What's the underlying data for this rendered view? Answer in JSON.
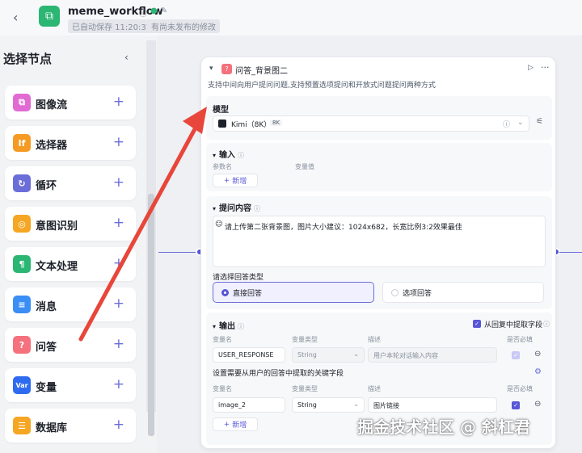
{
  "header": {
    "title": "meme_workflow",
    "saved_status": "已自动保存 11:20:37",
    "publish_status": "有尚未发布的修改"
  },
  "sidebar": {
    "title": "选择节点",
    "items": [
      {
        "label": "图像流",
        "icon": "image-flow-icon",
        "color": "#e16bd3",
        "glyph": "⧉"
      },
      {
        "label": "选择器",
        "icon": "selector-icon",
        "color": "#f59a23",
        "glyph": "If"
      },
      {
        "label": "循环",
        "icon": "loop-icon",
        "color": "#6b6ed8",
        "glyph": "↻"
      },
      {
        "label": "意图识别",
        "icon": "intent-icon",
        "color": "#f5a623",
        "glyph": "◎"
      },
      {
        "label": "文本处理",
        "icon": "text-process-icon",
        "color": "#2bb673",
        "glyph": "¶"
      },
      {
        "label": "消息",
        "icon": "message-icon",
        "color": "#3a8ef6",
        "glyph": "≡"
      },
      {
        "label": "问答",
        "icon": "qa-icon",
        "color": "#f4717d",
        "glyph": "?"
      },
      {
        "label": "变量",
        "icon": "variable-icon",
        "color": "#2f6bf0",
        "glyph": "Var"
      },
      {
        "label": "数据库",
        "icon": "database-icon",
        "color": "#f5a623",
        "glyph": "☰"
      }
    ]
  },
  "node": {
    "title": "问答_背景图二",
    "description": "支持中间向用户提问问题,支持预置选项提问和开放式问题提问两种方式",
    "model": {
      "section_label": "模型",
      "name": "Kimi（8K）",
      "tag": "8K"
    },
    "input": {
      "section_label": "输入",
      "col_param": "参数名",
      "col_value": "变量值",
      "add_label": "新增"
    },
    "prompt": {
      "section_label": "提问内容",
      "text": "请上传第二张背景图，图片大小建议：1024x682，长宽比例3:2效果最佳"
    },
    "reply_type": {
      "label": "请选择回答类型",
      "options": [
        "直接回答",
        "选项回答"
      ],
      "selected": "直接回答"
    },
    "output": {
      "section_label": "输出",
      "extract_label": "从回复中提取字段",
      "extract_checked": true,
      "col_name": "变量名",
      "col_type": "变量类型",
      "col_desc": "描述",
      "col_required": "是否必填",
      "row1": {
        "name": "USER_RESPONSE",
        "type": "String",
        "desc": "用户本轮对话输入内容"
      },
      "key_fields_label": "设置需要从用户的回答中提取的关键字段",
      "row2": {
        "name": "image_2",
        "type": "String",
        "desc": "图片链接"
      },
      "add_label": "新增"
    }
  },
  "watermark": "掘金技术社区 @ 斜杠君",
  "colors": {
    "accent": "#5856d6",
    "arrow": "#e8463a"
  }
}
